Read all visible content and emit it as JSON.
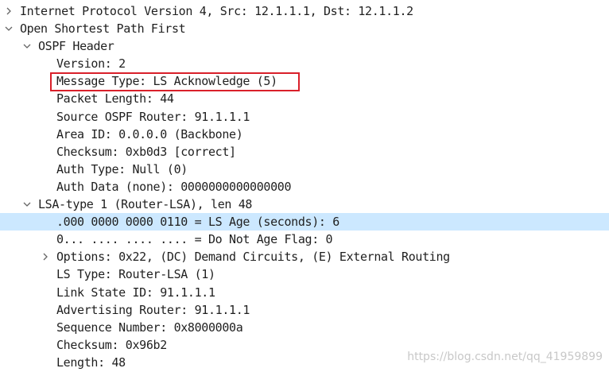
{
  "tree": [
    {
      "text": "Internet Protocol Version 4, Src: 12.1.1.1, Dst: 12.1.1.2",
      "level": 0,
      "toggle": "collapsed"
    },
    {
      "text": "Open Shortest Path First",
      "level": 0,
      "toggle": "expanded"
    },
    {
      "text": "OSPF Header",
      "level": 1,
      "toggle": "expanded"
    },
    {
      "text": "Version: 2",
      "level": 2,
      "toggle": "none"
    },
    {
      "text": "Message Type: LS Acknowledge (5)",
      "level": 2,
      "toggle": "none"
    },
    {
      "text": "Packet Length: 44",
      "level": 2,
      "toggle": "none"
    },
    {
      "text": "Source OSPF Router: 91.1.1.1",
      "level": 2,
      "toggle": "none"
    },
    {
      "text": "Area ID: 0.0.0.0 (Backbone)",
      "level": 2,
      "toggle": "none"
    },
    {
      "text": "Checksum: 0xb0d3 [correct]",
      "level": 2,
      "toggle": "none"
    },
    {
      "text": "Auth Type: Null (0)",
      "level": 2,
      "toggle": "none"
    },
    {
      "text": "Auth Data (none): 0000000000000000",
      "level": 2,
      "toggle": "none"
    },
    {
      "text": "LSA-type 1 (Router-LSA), len 48",
      "level": 1,
      "toggle": "expanded"
    },
    {
      "text": ".000 0000 0000 0110 = LS Age (seconds): 6",
      "level": 2,
      "toggle": "none",
      "selected": true
    },
    {
      "text": "0... .... .... .... = Do Not Age Flag: 0",
      "level": 2,
      "toggle": "none"
    },
    {
      "text": "Options: 0x22, (DC) Demand Circuits, (E) External Routing",
      "level": 2,
      "toggle": "collapsed"
    },
    {
      "text": "LS Type: Router-LSA (1)",
      "level": 2,
      "toggle": "none"
    },
    {
      "text": "Link State ID: 91.1.1.1",
      "level": 2,
      "toggle": "none"
    },
    {
      "text": "Advertising Router: 91.1.1.1",
      "level": 2,
      "toggle": "none"
    },
    {
      "text": "Sequence Number: 0x8000000a",
      "level": 2,
      "toggle": "none"
    },
    {
      "text": "Checksum: 0x96b2",
      "level": 2,
      "toggle": "none"
    },
    {
      "text": "Length: 48",
      "level": 2,
      "toggle": "none"
    }
  ],
  "watermark": "https://blog.csdn.net/qq_41959899",
  "colors": {
    "selection": "#cce8ff",
    "highlight_border": "#d9202a"
  }
}
